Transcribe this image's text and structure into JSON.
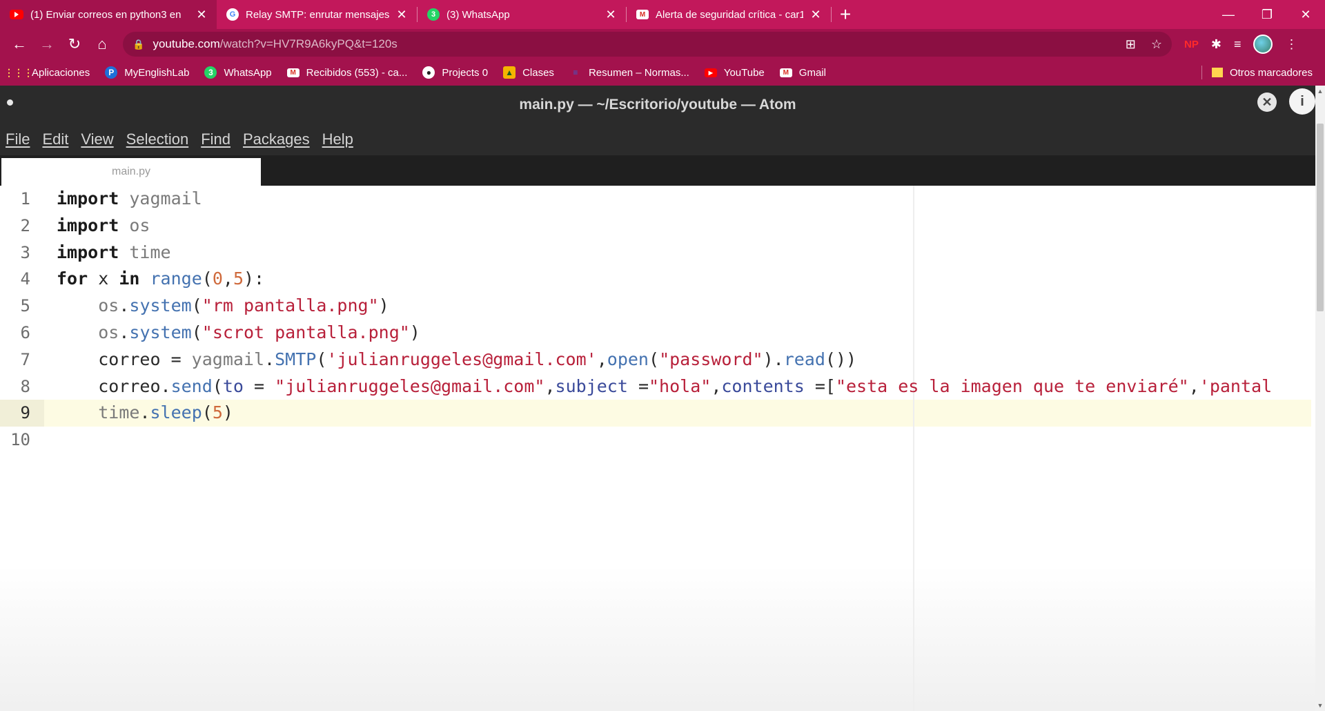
{
  "browser": {
    "tabs": [
      {
        "title": "(1) Enviar correos en python3 en",
        "favicon": "youtube-icon",
        "active": true
      },
      {
        "title": "Relay SMTP: enrutar mensajes sa",
        "favicon": "google-icon",
        "active": false
      },
      {
        "title": "(3) WhatsApp",
        "favicon": "whatsapp-icon",
        "active": false
      },
      {
        "title": "Alerta de seguridad crítica - car1",
        "favicon": "gmail-icon",
        "active": false
      }
    ],
    "address": {
      "host": "youtube.com",
      "path": "/watch?v=HV7R9A6kyPQ&t=120s"
    },
    "bookmarks": [
      {
        "label": "Aplicaciones",
        "icon": "apps-grid-icon"
      },
      {
        "label": "MyEnglishLab",
        "icon": "pearson-icon"
      },
      {
        "label": "WhatsApp",
        "icon": "whatsapp-icon"
      },
      {
        "label": "Recibidos (553) - ca...",
        "icon": "gmail-icon"
      },
      {
        "label": "Projects 0",
        "icon": "github-icon"
      },
      {
        "label": "Clases",
        "icon": "classroom-icon"
      },
      {
        "label": "Resumen – Normas...",
        "icon": "doc-icon"
      },
      {
        "label": "YouTube",
        "icon": "youtube-icon"
      },
      {
        "label": "Gmail",
        "icon": "gmail-icon"
      }
    ],
    "other_bookmarks": "Otros marcadores",
    "extension_np": "NP",
    "theme_color": "#c2185b"
  },
  "atom": {
    "window_title": "main.py — ~/Escritorio/youtube — Atom",
    "menu": [
      "File",
      "Edit",
      "View",
      "Selection",
      "Find",
      "Packages",
      "Help"
    ],
    "tab": "main.py",
    "cursor_line": 9,
    "line_numbers": [
      "1",
      "2",
      "3",
      "4",
      "5",
      "6",
      "7",
      "8",
      "9",
      "10"
    ]
  }
}
